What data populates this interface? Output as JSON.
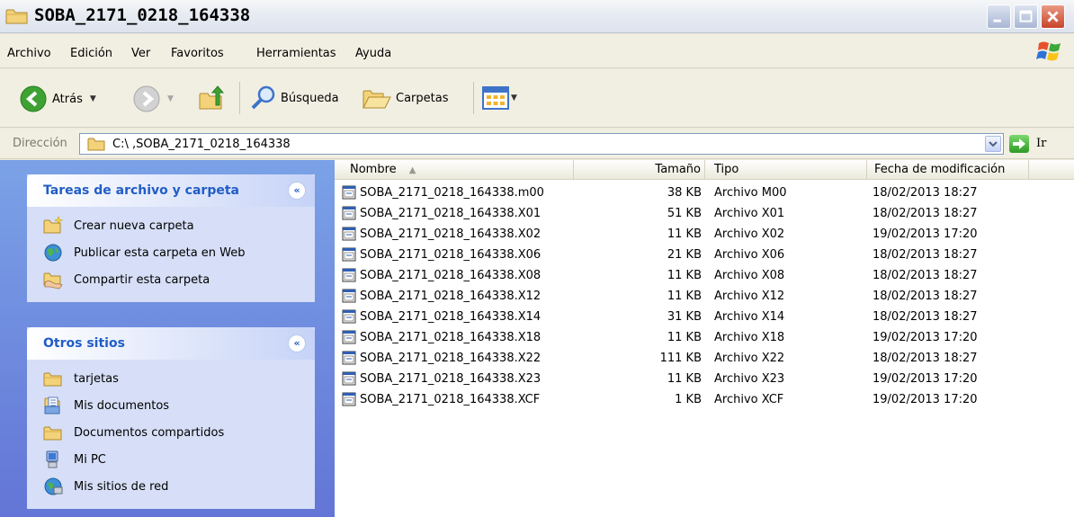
{
  "window": {
    "title": "SOBA_2171_0218_164338"
  },
  "menu": [
    "Archivo",
    "Edición",
    "Ver",
    "Favoritos",
    "Herramientas",
    "Ayuda"
  ],
  "toolbar": {
    "back_label": "Atrás",
    "search_label": "Búsqueda",
    "folders_label": "Carpetas"
  },
  "address": {
    "label": "Dirección",
    "path": "C:\\ ,SOBA_2171_0218_164338",
    "go_label": "Ir"
  },
  "tasks_panel": {
    "title": "Tareas de archivo y carpeta",
    "items": [
      {
        "label": "Crear nueva carpeta",
        "icon": "new-folder-icon"
      },
      {
        "label": "Publicar esta carpeta en Web",
        "icon": "publish-web-icon"
      },
      {
        "label": "Compartir esta carpeta",
        "icon": "share-folder-icon"
      }
    ]
  },
  "places_panel": {
    "title": "Otros sitios",
    "items": [
      {
        "label": "tarjetas",
        "icon": "folder-icon"
      },
      {
        "label": "Mis documentos",
        "icon": "my-documents-icon"
      },
      {
        "label": "Documentos compartidos",
        "icon": "folder-icon"
      },
      {
        "label": "Mi PC",
        "icon": "my-computer-icon"
      },
      {
        "label": "Mis sitios de red",
        "icon": "network-places-icon"
      }
    ]
  },
  "columns": {
    "name": "Nombre",
    "size": "Tamaño",
    "type": "Tipo",
    "date": "Fecha de modificación"
  },
  "files": [
    {
      "name": "SOBA_2171_0218_164338.m00",
      "size": "38 KB",
      "type": "Archivo M00",
      "date": "18/02/2013 18:27"
    },
    {
      "name": "SOBA_2171_0218_164338.X01",
      "size": "51 KB",
      "type": "Archivo X01",
      "date": "18/02/2013 18:27"
    },
    {
      "name": "SOBA_2171_0218_164338.X02",
      "size": "11 KB",
      "type": "Archivo X02",
      "date": "19/02/2013 17:20"
    },
    {
      "name": "SOBA_2171_0218_164338.X06",
      "size": "21 KB",
      "type": "Archivo X06",
      "date": "18/02/2013 18:27"
    },
    {
      "name": "SOBA_2171_0218_164338.X08",
      "size": "11 KB",
      "type": "Archivo X08",
      "date": "18/02/2013 18:27"
    },
    {
      "name": "SOBA_2171_0218_164338.X12",
      "size": "11 KB",
      "type": "Archivo X12",
      "date": "18/02/2013 18:27"
    },
    {
      "name": "SOBA_2171_0218_164338.X14",
      "size": "31 KB",
      "type": "Archivo X14",
      "date": "18/02/2013 18:27"
    },
    {
      "name": "SOBA_2171_0218_164338.X18",
      "size": "11 KB",
      "type": "Archivo X18",
      "date": "19/02/2013 17:20"
    },
    {
      "name": "SOBA_2171_0218_164338.X22",
      "size": "111 KB",
      "type": "Archivo X22",
      "date": "18/02/2013 18:27"
    },
    {
      "name": "SOBA_2171_0218_164338.X23",
      "size": "11 KB",
      "type": "Archivo X23",
      "date": "19/02/2013 17:20"
    },
    {
      "name": "SOBA_2171_0218_164338.XCF",
      "size": "1 KB",
      "type": "Archivo XCF",
      "date": "19/02/2013 17:20"
    }
  ]
}
